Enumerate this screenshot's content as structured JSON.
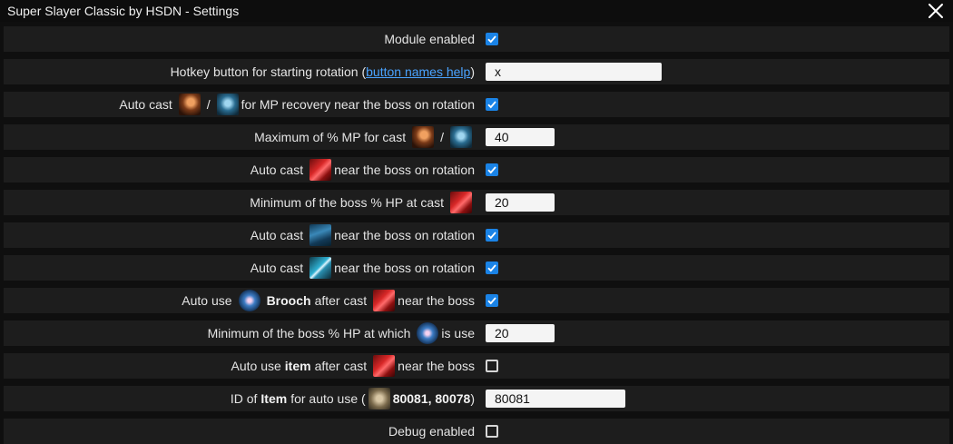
{
  "window": {
    "title": "Super Slayer Classic by HSDN - Settings"
  },
  "labels": {
    "module_enabled": "Module enabled",
    "hotkey_prefix": "Hotkey button for starting rotation (",
    "hotkey_link": "button names help",
    "hotkey_suffix": ")",
    "auto_cast": "Auto cast",
    "mp_recovery_suffix": "for MP recovery near the boss on rotation",
    "max_mp": "Maximum of % MP for cast",
    "near_boss_rotation": "near the boss on rotation",
    "min_boss_hp_cast": "Minimum of the boss % HP at cast",
    "auto_use": "Auto use",
    "brooch": "Brooch",
    "after_cast": "after cast",
    "near_boss": "near the boss",
    "min_boss_hp_which": "Minimum of the boss % HP at which",
    "is_use": "is use",
    "item": "item",
    "id_of": "ID of",
    "item_cap": "Item",
    "for_auto_use": "for auto use (",
    "item_ids": "80081, 80078",
    "close_paren": ")",
    "debug_enabled": "Debug enabled",
    "slash": "/"
  },
  "values": {
    "hotkey": "x",
    "max_mp": "40",
    "min_hp_cast": "20",
    "min_hp_brooch": "20",
    "item_id": "80081"
  },
  "colors": {
    "checkbox_on": "#1a83e6",
    "link": "#4aa3ff",
    "row_bg": "#1d1d1d",
    "page_bg": "#0f0f0f"
  }
}
